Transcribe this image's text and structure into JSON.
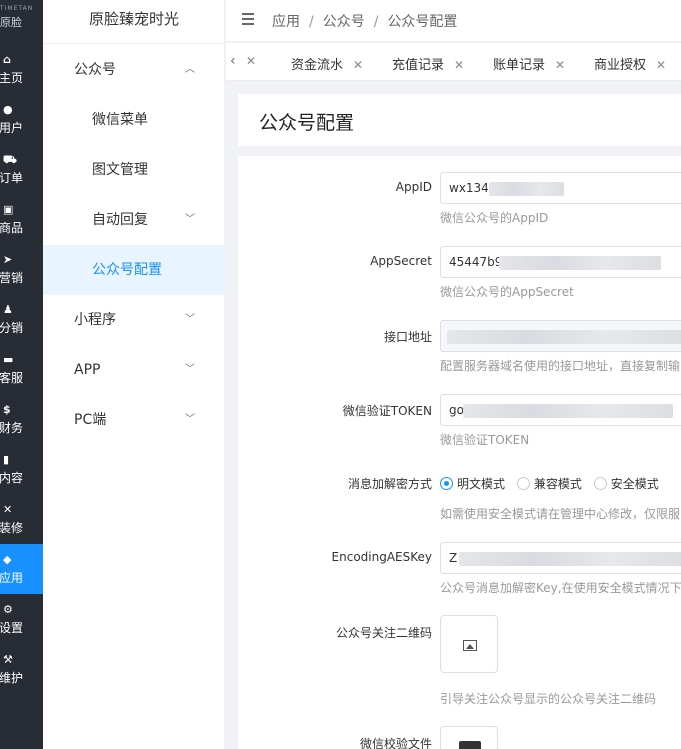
{
  "rail": {
    "logo_text": "原脸",
    "logo_latin": "TIMETAN",
    "items": [
      {
        "label": "主页",
        "icon": "home-icon",
        "glyph": "⌂"
      },
      {
        "label": "用户",
        "icon": "user-icon",
        "glyph": "●"
      },
      {
        "label": "订单",
        "icon": "cart-icon",
        "glyph": "⛟"
      },
      {
        "label": "商品",
        "icon": "shop-icon",
        "glyph": "▣"
      },
      {
        "label": "营销",
        "icon": "send-icon",
        "glyph": "➤"
      },
      {
        "label": "分销",
        "icon": "team-icon",
        "glyph": "♟"
      },
      {
        "label": "客服",
        "icon": "chat-icon",
        "glyph": "▬"
      },
      {
        "label": "财务",
        "icon": "dollar-icon",
        "glyph": "$"
      },
      {
        "label": "内容",
        "icon": "book-icon",
        "glyph": "▮"
      },
      {
        "label": "装修",
        "icon": "tools-icon",
        "glyph": "✕"
      },
      {
        "label": "应用",
        "icon": "cube-icon",
        "glyph": "◆"
      },
      {
        "label": "设置",
        "icon": "gear-icon",
        "glyph": "⚙"
      },
      {
        "label": "维护",
        "icon": "hammer-icon",
        "glyph": "⚒"
      }
    ],
    "active_index": 10
  },
  "submenu": {
    "brand": "原脸臻宠时光",
    "items": [
      {
        "label": "公众号",
        "type": "group",
        "arrow": "up"
      },
      {
        "label": "微信菜单",
        "type": "child"
      },
      {
        "label": "图文管理",
        "type": "child"
      },
      {
        "label": "自动回复",
        "type": "child",
        "arrow": "down"
      },
      {
        "label": "公众号配置",
        "type": "child",
        "active": true
      },
      {
        "label": "小程序",
        "type": "group",
        "arrow": "down"
      },
      {
        "label": "APP",
        "type": "group",
        "arrow": "down"
      },
      {
        "label": "PC端",
        "type": "group",
        "arrow": "down"
      }
    ]
  },
  "header": {
    "breadcrumb": [
      "应用",
      "公众号",
      "公众号配置"
    ],
    "separator": "/"
  },
  "tabs": {
    "prev_glyph": "‹",
    "close_glyph": "✕",
    "items": [
      "资金流水",
      "充值记录",
      "账单记录",
      "商业授权"
    ]
  },
  "page": {
    "title": "公众号配置"
  },
  "form": {
    "appid": {
      "label": "AppID",
      "value": "wx1348",
      "help": "微信公众号的AppID"
    },
    "appsecret": {
      "label": "AppSecret",
      "value": "45447b9",
      "help": "微信公众号的AppSecret"
    },
    "api_url": {
      "label": "接口地址",
      "value": "",
      "help": "配置服务器域名使用的接口地址，直接复制输"
    },
    "token": {
      "label": "微信验证TOKEN",
      "value": "go",
      "help": "微信验证TOKEN"
    },
    "encrypt_mode": {
      "label": "消息加解密方式",
      "options": [
        "明文模式",
        "兼容模式",
        "安全模式"
      ],
      "selected": "明文模式",
      "help": "如需使用安全模式请在管理中心修改，仅限服"
    },
    "aes_key": {
      "label": "EncodingAESKey",
      "value": "Z",
      "help": "公众号消息加解密Key,在使用安全模式情况下"
    },
    "qrcode": {
      "label": "公众号关注二维码",
      "help": "引导关注公众号显示的公众号关注二维码"
    },
    "verify_file": {
      "label": "微信校验文件"
    }
  },
  "colors": {
    "accent": "#1890ff",
    "rail_bg": "#282c34",
    "active_bg": "#e8f4ff"
  }
}
